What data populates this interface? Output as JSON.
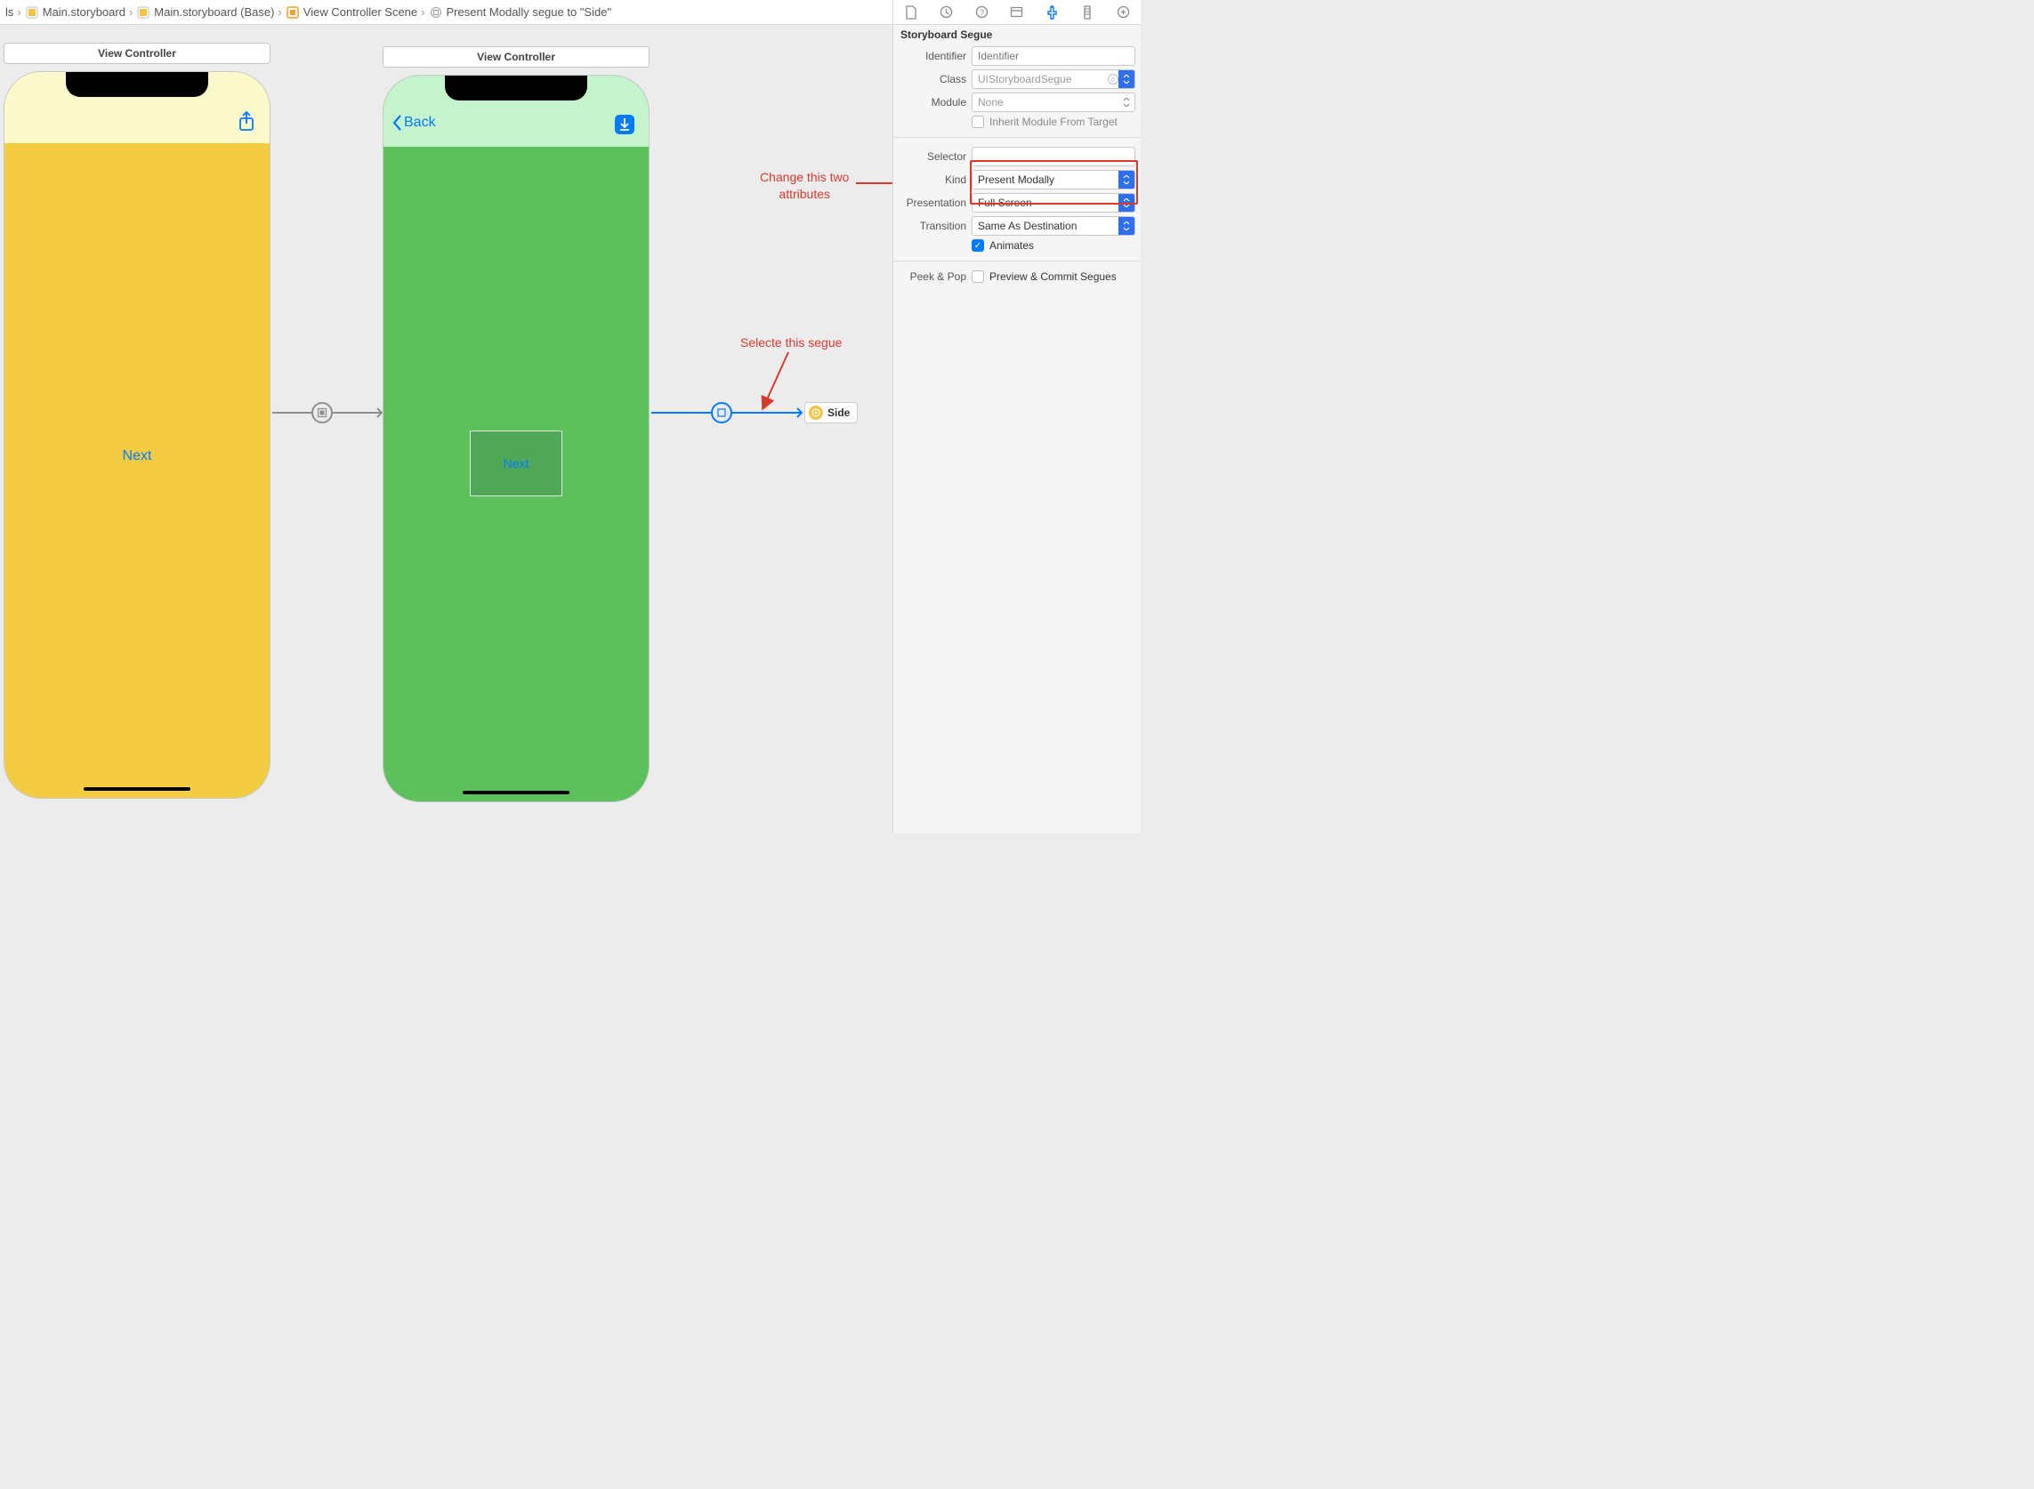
{
  "breadcrumb": {
    "item0": "ls",
    "item1": "Main.storyboard",
    "item2": "Main.storyboard (Base)",
    "item3": "View Controller Scene",
    "item4": "Present Modally segue to \"Side\""
  },
  "canvas": {
    "vc1_title": "View Controller",
    "vc2_title": "View Controller",
    "vc1_button": "Next",
    "vc2_back": "Back",
    "vc2_button": "Next",
    "side_ref": "Side"
  },
  "annotations": {
    "change_attrs_l1": "Change this two",
    "change_attrs_l2": "attributes",
    "select_segue": "Selecte this segue"
  },
  "inspector": {
    "section": "Storyboard Segue",
    "identifier_label": "Identifier",
    "identifier_placeholder": "Identifier",
    "class_label": "Class",
    "class_placeholder": "UIStoryboardSegue",
    "module_label": "Module",
    "module_placeholder": "None",
    "inherit_label": "Inherit Module From Target",
    "selector_label": "Selector",
    "kind_label": "Kind",
    "kind_value": "Present Modally",
    "presentation_label": "Presentation",
    "presentation_value": "Full Screen",
    "transition_label": "Transition",
    "transition_value": "Same As Destination",
    "animates_label": "Animates",
    "peek_label": "Peek & Pop",
    "peek_option": "Preview & Commit Segues"
  }
}
